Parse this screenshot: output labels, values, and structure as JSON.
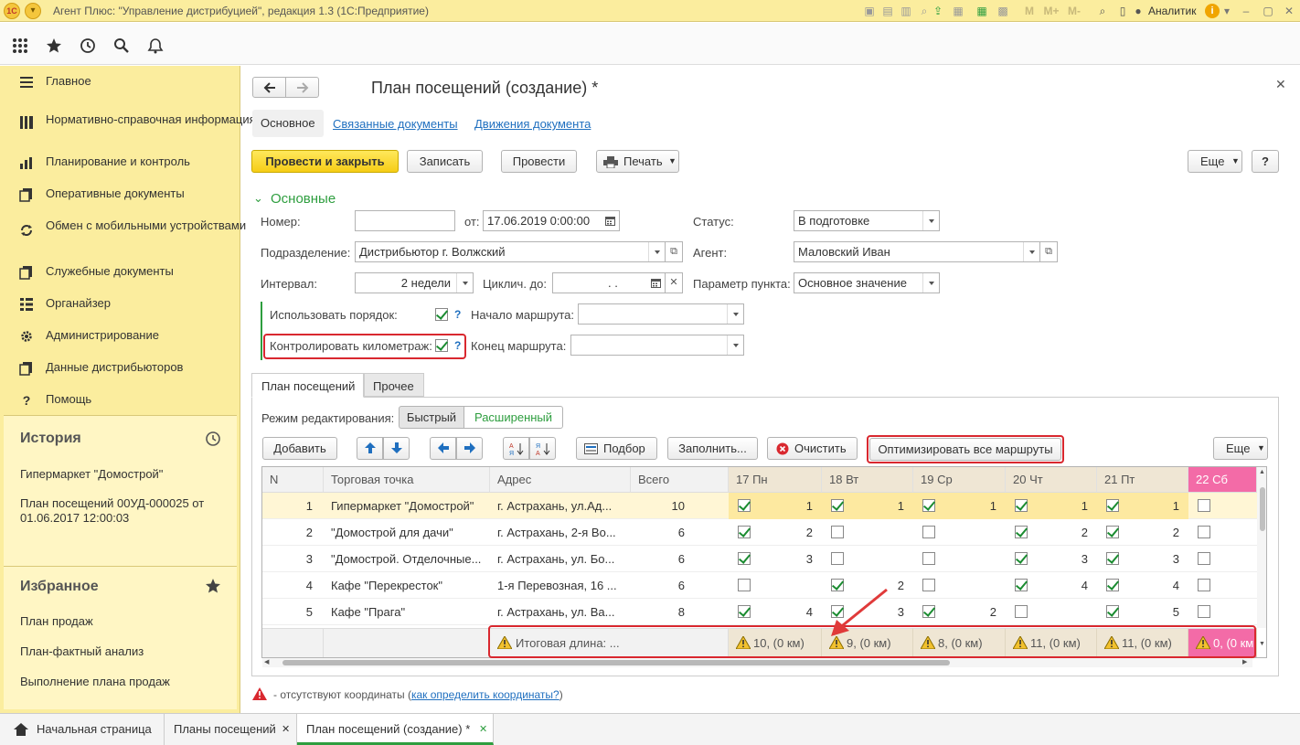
{
  "window": {
    "title": "Агент Плюс: \"Управление дистрибуцией\", редакция 1.3  (1С:Предприятие)",
    "user": "Аналитик",
    "logo_text": "1С"
  },
  "sidebar": {
    "items": [
      {
        "label": "Главное",
        "icon": "menu-lines-icon"
      },
      {
        "label": "Нормативно-справочная информация",
        "icon": "bars-icon"
      },
      {
        "label": "Планирование и контроль",
        "icon": "bar-chart-icon"
      },
      {
        "label": "Оперативные документы",
        "icon": "documents-icon"
      },
      {
        "label": "Обмен с мобильными устройствами",
        "icon": "sync-icon"
      },
      {
        "label": "Служебные документы",
        "icon": "documents-icon"
      },
      {
        "label": "Органайзер",
        "icon": "organizer-icon"
      },
      {
        "label": "Администрирование",
        "icon": "gear-icon"
      },
      {
        "label": "Данные дистрибьюторов",
        "icon": "documents-icon"
      },
      {
        "label": "Помощь",
        "icon": "question-icon"
      }
    ],
    "history": {
      "title": "История",
      "items": [
        "Гипермаркет \"Домострой\"",
        "План посещений 00УД-000025 от 01.06.2017 12:00:03"
      ]
    },
    "favorites": {
      "title": "Избранное",
      "items": [
        "План продаж",
        "План-фактный анализ",
        "Выполнение плана продаж"
      ]
    }
  },
  "form": {
    "title": "План посещений  (создание) *",
    "tabs": [
      "Основное",
      "Связанные документы",
      "Движения документа"
    ],
    "buttons": {
      "post_close": "Провести и закрыть",
      "save": "Записать",
      "post": "Провести",
      "print": "Печать",
      "more": "Еще",
      "help": "?"
    },
    "section_title": "Основные",
    "fields": {
      "number_label": "Номер:",
      "number_value": "",
      "date_label": "от:",
      "date_value": "17.06.2019  0:00:00",
      "status_label": "Статус:",
      "status_value": "В подготовке",
      "division_label": "Подразделение:",
      "division_value": "Дистрибьютор г. Волжский",
      "agent_label": "Агент:",
      "agent_value": "Маловский Иван",
      "interval_label": "Интервал:",
      "interval_value": "2 недели",
      "cyclic_label": "Циклич. до:",
      "cyclic_value": ".    .",
      "point_param_label": "Параметр пункта:",
      "point_param_value": "Основное значение",
      "use_order_label": "Использовать порядок:",
      "use_order_checked": true,
      "route_start_label": "Начало маршрута:",
      "route_start_value": "",
      "control_km_label": "Контролировать километраж:",
      "control_km_checked": true,
      "route_end_label": "Конец маршрута:",
      "route_end_value": "",
      "help_mark": "?"
    },
    "inner_tabs": [
      "План посещений",
      "Прочее"
    ],
    "edit_mode": {
      "label": "Режим редактирования:",
      "options": [
        "Быстрый",
        "Расширенный"
      ],
      "selected": "Быстрый"
    },
    "table_toolbar": {
      "add": "Добавить",
      "pick": "Подбор",
      "fill": "Заполнить...",
      "clear": "Очистить",
      "optimize": "Оптимизировать все маршруты",
      "more": "Еще"
    }
  },
  "table": {
    "columns": [
      "N",
      "Торговая точка",
      "Адрес",
      "Всего",
      "17 Пн",
      "18 Вт",
      "19 Ср",
      "20 Чт",
      "21 Пт",
      "22 Сб"
    ],
    "rows": [
      {
        "n": "1",
        "point": "Гипермаркет \"Домострой\"",
        "address": "г. Астрахань, ул.Ад...",
        "total": "10",
        "days": [
          {
            "c": true,
            "v": "1"
          },
          {
            "c": true,
            "v": "1"
          },
          {
            "c": true,
            "v": "1"
          },
          {
            "c": true,
            "v": "1"
          },
          {
            "c": true,
            "v": "1"
          },
          {
            "c": false,
            "v": ""
          }
        ]
      },
      {
        "n": "2",
        "point": "\"Домострой для дачи\"",
        "address": "г. Астрахань, 2-я Во...",
        "total": "6",
        "days": [
          {
            "c": true,
            "v": "2"
          },
          {
            "c": false,
            "v": ""
          },
          {
            "c": false,
            "v": ""
          },
          {
            "c": true,
            "v": "2"
          },
          {
            "c": true,
            "v": "2"
          },
          {
            "c": false,
            "v": ""
          }
        ]
      },
      {
        "n": "3",
        "point": "\"Домострой. Отделочные...",
        "address": "г. Астрахань, ул. Бо...",
        "total": "6",
        "days": [
          {
            "c": true,
            "v": "3"
          },
          {
            "c": false,
            "v": ""
          },
          {
            "c": false,
            "v": ""
          },
          {
            "c": true,
            "v": "3"
          },
          {
            "c": true,
            "v": "3"
          },
          {
            "c": false,
            "v": ""
          }
        ]
      },
      {
        "n": "4",
        "point": "Кафе \"Перекресток\"",
        "address": "1-я Перевозная, 16 ...",
        "total": "6",
        "days": [
          {
            "c": false,
            "v": ""
          },
          {
            "c": true,
            "v": "2"
          },
          {
            "c": false,
            "v": ""
          },
          {
            "c": true,
            "v": "4"
          },
          {
            "c": true,
            "v": "4"
          },
          {
            "c": false,
            "v": ""
          }
        ]
      },
      {
        "n": "5",
        "point": "Кафе \"Прага\"",
        "address": "г. Астрахань, ул. Ва...",
        "total": "8",
        "days": [
          {
            "c": true,
            "v": "4"
          },
          {
            "c": true,
            "v": "3"
          },
          {
            "c": true,
            "v": "2"
          },
          {
            "c": false,
            "v": ""
          },
          {
            "c": true,
            "v": "5"
          },
          {
            "c": false,
            "v": ""
          }
        ]
      }
    ],
    "footer": {
      "label": "Итоговая длина: ...",
      "days": [
        "10, (0 км)",
        "9, (0 км)",
        "8, (0 км)",
        "11, (0 км)",
        "11, (0 км)",
        "0, (0 км"
      ]
    }
  },
  "legend": {
    "text": "- отсутствуют координаты (",
    "link": "как определить координаты?",
    "close": ")"
  },
  "bottom_tabs": {
    "home": "Начальная страница",
    "items": [
      "Планы посещений",
      "План посещений  (создание) *"
    ]
  },
  "colors": {
    "sidebar_bg": "#fbed9e",
    "accent_green": "#2e9e3f",
    "highlight_red": "#d9282f",
    "saturday_pink": "#f36ba7",
    "post_button_yellow": "#f6cd16"
  }
}
